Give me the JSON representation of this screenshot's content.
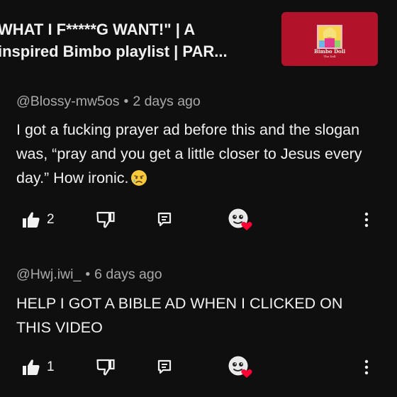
{
  "video": {
    "title_line1": "WHAT I F*****G WANT!\" | A",
    "title_line2": "inspired Bimbo playlist | PAR...",
    "thumbnail_caption": "Bimbo Doll",
    "thumbnail_subcaption": "The Doll",
    "thumbnail_color": "#b3122b"
  },
  "comments": [
    {
      "author": "@Blossy-mw5os",
      "time": "2 days ago",
      "separator": "•",
      "text": "I got a fucking prayer ad before this and the slogan was, “pray and you get a little closer to Jesus every day.” How ironic.",
      "emoji": "crying-face",
      "likes": "2"
    },
    {
      "author": "@Hwj.iwi_",
      "time": "6 days ago",
      "separator": "•",
      "text": "HELP I GOT A BIBLE AD WHEN I CLICKED ON THIS VIDEO",
      "emoji": "",
      "likes": "1"
    }
  ],
  "icons": {
    "like": "thumbs-up-icon",
    "dislike": "thumbs-down-icon",
    "reply": "reply-icon",
    "creator_heart": "creator-heart-icon",
    "more": "more-vert-icon"
  },
  "colors": {
    "background": "#0f0f0f",
    "text": "#f1f1f1",
    "meta": "#aaaaaa",
    "heart": "#ff0033"
  }
}
